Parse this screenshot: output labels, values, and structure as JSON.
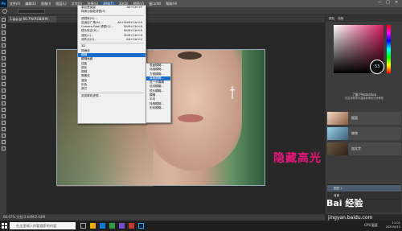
{
  "app": {
    "logo": "Ps"
  },
  "menubar": [
    "文件(F)",
    "编辑(E)",
    "图像(I)",
    "图层(L)",
    "文字(Y)",
    "选择(S)",
    "滤镜(T)",
    "3D(D)",
    "视图(V)",
    "窗口(W)",
    "帮助(H)"
  ],
  "window_controls": [
    "—",
    "□",
    "✕"
  ],
  "tab": {
    "title": "1.jpg @ 66.7%(RGB/8#)"
  },
  "filter_menu": {
    "items": [
      {
        "label": "高反差保留",
        "shortcut": "Alt+Ctrl+F"
      },
      {
        "label": "转换为智能滤镜(S)",
        "shortcut": ""
      },
      {
        "sep": true
      },
      {
        "label": "滤镜库(G)...",
        "shortcut": ""
      },
      {
        "label": "自适应广角(A)...",
        "shortcut": "Alt+Shift+Ctrl+A"
      },
      {
        "label": "Camera Raw 滤镜(C)...",
        "shortcut": "Shift+Ctrl+A"
      },
      {
        "label": "镜头校正(R)...",
        "shortcut": "Shift+Ctrl+R"
      },
      {
        "label": "液化(L)...",
        "shortcut": "Shift+Ctrl+X"
      },
      {
        "label": "消失点(V)...",
        "shortcut": "Alt+Ctrl+V"
      },
      {
        "sep": true
      },
      {
        "label": "3D",
        "shortcut": ""
      },
      {
        "label": "风格化",
        "shortcut": ""
      },
      {
        "label": "模糊",
        "shortcut": "",
        "selected": true
      },
      {
        "label": "模糊画廊",
        "shortcut": ""
      },
      {
        "label": "扭曲",
        "shortcut": ""
      },
      {
        "label": "锐化",
        "shortcut": ""
      },
      {
        "label": "视频",
        "shortcut": ""
      },
      {
        "label": "像素化",
        "shortcut": ""
      },
      {
        "label": "渲染",
        "shortcut": ""
      },
      {
        "label": "杂色",
        "shortcut": ""
      },
      {
        "label": "其它",
        "shortcut": ""
      },
      {
        "sep": true
      },
      {
        "label": "浏览联机滤镜...",
        "shortcut": ""
      }
    ]
  },
  "blur_submenu": {
    "items": [
      {
        "label": "表面模糊..."
      },
      {
        "label": "动感模糊..."
      },
      {
        "label": "方框模糊..."
      },
      {
        "label": "高斯模糊...",
        "selected": true
      },
      {
        "label": "进一步模糊"
      },
      {
        "label": "径向模糊..."
      },
      {
        "label": "镜头模糊..."
      },
      {
        "label": "模糊"
      },
      {
        "label": "平均"
      },
      {
        "label": "特殊模糊..."
      },
      {
        "label": "形状模糊..."
      }
    ]
  },
  "overlay_text": "隐藏高光",
  "right_panel": {
    "tabs": [
      "颜色",
      "色板"
    ],
    "circle_value": "53",
    "learn_title": "了解 Photoshop",
    "learn_sub": "在应用程序中直接获得的分步教程",
    "cards": [
      "图案",
      "修饰",
      "加文字"
    ],
    "layers": [
      "图层 1",
      "背景"
    ]
  },
  "statusbar": {
    "text": "66.67%   文档:2.64M/2.64M"
  },
  "taskbar": {
    "search_placeholder": "在这里输入你要搜索的内容",
    "clock_time": "11:01",
    "clock_date": "2020/4/12",
    "tray": "CPU温度"
  },
  "watermark": {
    "main": "Bai 经验",
    "sub": "jingyan.baidu.com"
  },
  "colors": {
    "accent": "#1a6ec9",
    "overlay": "#e8167a",
    "ps_bg": "#001e36"
  }
}
